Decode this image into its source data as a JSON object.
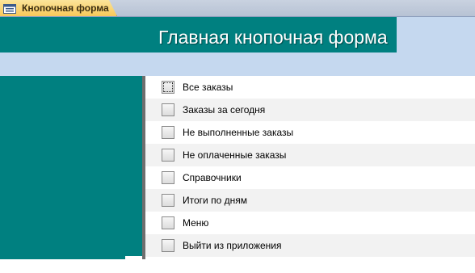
{
  "tab": {
    "label": "Кнопочная форма",
    "icon": "form-icon"
  },
  "header": {
    "title": "Главная кнопочная форма"
  },
  "colors": {
    "teal": "#008080",
    "header_band": "#c5d8ef",
    "row_alt": "#f2f2f2",
    "divider": "#6e6e6e"
  },
  "menu": {
    "items": [
      {
        "label": "Все заказы",
        "focused": true
      },
      {
        "label": "Заказы за сегодня",
        "focused": false
      },
      {
        "label": "Не выполненные заказы",
        "focused": false
      },
      {
        "label": "Не оплаченные заказы",
        "focused": false
      },
      {
        "label": "Справочники",
        "focused": false
      },
      {
        "label": "Итоги по дням",
        "focused": false
      },
      {
        "label": "Меню",
        "focused": false
      },
      {
        "label": "Выйти из приложения",
        "focused": false
      }
    ]
  }
}
